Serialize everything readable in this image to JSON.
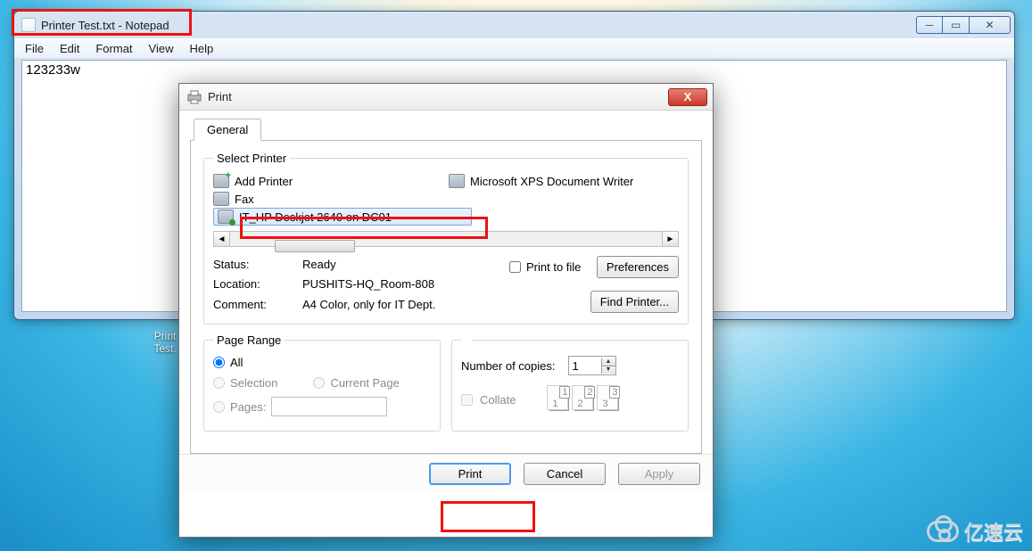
{
  "notepad": {
    "title": "Printer Test.txt - Notepad",
    "menu": {
      "file": "File",
      "edit": "Edit",
      "format": "Format",
      "view": "View",
      "help": "Help"
    },
    "content": "123233w"
  },
  "desktop_icon": {
    "line1": "Print",
    "line2": "Test."
  },
  "print_dialog": {
    "title": "Print",
    "tab_general": "General",
    "group_select_printer": "Select Printer",
    "printers": {
      "add_printer": "Add Printer",
      "fax": "Fax",
      "xps": "Microsoft XPS Document Writer",
      "selected": "IT_HP Deskjet 2640 on DC01"
    },
    "labels": {
      "status": "Status:",
      "location": "Location:",
      "comment": "Comment:",
      "print_to_file": "Print to file",
      "preferences": "Preferences",
      "find_printer": "Find Printer...",
      "page_range": "Page Range",
      "all": "All",
      "selection": "Selection",
      "current_page": "Current Page",
      "pages": "Pages:",
      "number_of_copies": "Number of copies:",
      "collate": "Collate",
      "print": "Print",
      "cancel": "Cancel",
      "apply": "Apply"
    },
    "values": {
      "status": "Ready",
      "location": "PUSHITS-HQ_Room-808",
      "comment": "A4 Color, only for IT Dept.",
      "copies": "1",
      "pages_input": ""
    },
    "collate_icons": [
      "1",
      "2",
      "3"
    ]
  },
  "watermark": "亿速云"
}
